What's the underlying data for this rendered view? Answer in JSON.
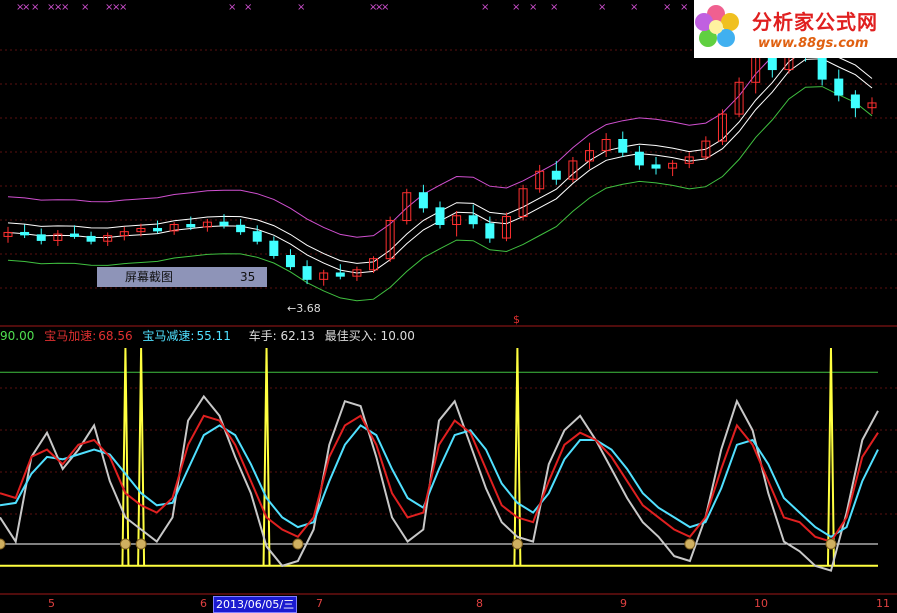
{
  "chart_data": [
    {
      "type": "candlestick",
      "panel": "price",
      "title": "",
      "low_marker_label": "←3.68",
      "colors": {
        "up": "#ff3030",
        "down": "#40ffff",
        "upper_band": "#d050d0",
        "mid_line": "#ffffff",
        "lower_band": "#40c040"
      },
      "candles": [
        {
          "o": 4.3,
          "h": 4.42,
          "l": 4.22,
          "c": 4.35
        },
        {
          "o": 4.35,
          "h": 4.45,
          "l": 4.28,
          "c": 4.32
        },
        {
          "o": 4.32,
          "h": 4.4,
          "l": 4.2,
          "c": 4.25
        },
        {
          "o": 4.25,
          "h": 4.38,
          "l": 4.18,
          "c": 4.33
        },
        {
          "o": 4.33,
          "h": 4.44,
          "l": 4.27,
          "c": 4.3
        },
        {
          "o": 4.3,
          "h": 4.36,
          "l": 4.2,
          "c": 4.24
        },
        {
          "o": 4.24,
          "h": 4.35,
          "l": 4.18,
          "c": 4.31
        },
        {
          "o": 4.31,
          "h": 4.42,
          "l": 4.25,
          "c": 4.36
        },
        {
          "o": 4.36,
          "h": 4.46,
          "l": 4.3,
          "c": 4.4
        },
        {
          "o": 4.4,
          "h": 4.5,
          "l": 4.34,
          "c": 4.37
        },
        {
          "o": 4.37,
          "h": 4.48,
          "l": 4.32,
          "c": 4.45
        },
        {
          "o": 4.45,
          "h": 4.55,
          "l": 4.38,
          "c": 4.42
        },
        {
          "o": 4.42,
          "h": 4.52,
          "l": 4.36,
          "c": 4.48
        },
        {
          "o": 4.48,
          "h": 4.58,
          "l": 4.4,
          "c": 4.44
        },
        {
          "o": 4.44,
          "h": 4.52,
          "l": 4.32,
          "c": 4.36
        },
        {
          "o": 4.36,
          "h": 4.44,
          "l": 4.2,
          "c": 4.24
        },
        {
          "o": 4.24,
          "h": 4.3,
          "l": 4.02,
          "c": 4.06
        },
        {
          "o": 4.06,
          "h": 4.14,
          "l": 3.88,
          "c": 3.92
        },
        {
          "o": 3.92,
          "h": 4.0,
          "l": 3.7,
          "c": 3.76
        },
        {
          "o": 3.76,
          "h": 3.88,
          "l": 3.68,
          "c": 3.84
        },
        {
          "o": 3.84,
          "h": 3.95,
          "l": 3.76,
          "c": 3.8
        },
        {
          "o": 3.8,
          "h": 3.92,
          "l": 3.74,
          "c": 3.88
        },
        {
          "o": 3.88,
          "h": 4.05,
          "l": 3.84,
          "c": 4.02
        },
        {
          "o": 4.02,
          "h": 4.55,
          "l": 3.98,
          "c": 4.5
        },
        {
          "o": 4.5,
          "h": 4.9,
          "l": 4.45,
          "c": 4.85
        },
        {
          "o": 4.85,
          "h": 4.95,
          "l": 4.6,
          "c": 4.66
        },
        {
          "o": 4.66,
          "h": 4.74,
          "l": 4.4,
          "c": 4.45
        },
        {
          "o": 4.45,
          "h": 4.62,
          "l": 4.3,
          "c": 4.56
        },
        {
          "o": 4.56,
          "h": 4.7,
          "l": 4.4,
          "c": 4.46
        },
        {
          "o": 4.46,
          "h": 4.55,
          "l": 4.22,
          "c": 4.28
        },
        {
          "o": 4.28,
          "h": 4.6,
          "l": 4.24,
          "c": 4.55
        },
        {
          "o": 4.55,
          "h": 4.95,
          "l": 4.5,
          "c": 4.9
        },
        {
          "o": 4.9,
          "h": 5.2,
          "l": 4.85,
          "c": 5.12
        },
        {
          "o": 5.12,
          "h": 5.25,
          "l": 4.95,
          "c": 5.02
        },
        {
          "o": 5.02,
          "h": 5.3,
          "l": 4.98,
          "c": 5.25
        },
        {
          "o": 5.25,
          "h": 5.48,
          "l": 5.15,
          "c": 5.38
        },
        {
          "o": 5.38,
          "h": 5.6,
          "l": 5.3,
          "c": 5.52
        },
        {
          "o": 5.52,
          "h": 5.62,
          "l": 5.3,
          "c": 5.36
        },
        {
          "o": 5.36,
          "h": 5.44,
          "l": 5.14,
          "c": 5.2
        },
        {
          "o": 5.2,
          "h": 5.3,
          "l": 5.08,
          "c": 5.16
        },
        {
          "o": 5.16,
          "h": 5.26,
          "l": 5.06,
          "c": 5.22
        },
        {
          "o": 5.22,
          "h": 5.36,
          "l": 5.16,
          "c": 5.3
        },
        {
          "o": 5.3,
          "h": 5.56,
          "l": 5.26,
          "c": 5.5
        },
        {
          "o": 5.5,
          "h": 5.9,
          "l": 5.45,
          "c": 5.84
        },
        {
          "o": 5.84,
          "h": 6.3,
          "l": 5.8,
          "c": 6.24
        },
        {
          "o": 6.24,
          "h": 6.7,
          "l": 6.1,
          "c": 6.6
        },
        {
          "o": 6.6,
          "h": 6.85,
          "l": 6.3,
          "c": 6.4
        },
        {
          "o": 6.4,
          "h": 6.9,
          "l": 6.35,
          "c": 6.82
        },
        {
          "o": 6.82,
          "h": 7.05,
          "l": 6.5,
          "c": 6.58
        },
        {
          "o": 6.58,
          "h": 6.78,
          "l": 6.2,
          "c": 6.28
        },
        {
          "o": 6.28,
          "h": 6.4,
          "l": 6.0,
          "c": 6.08
        },
        {
          "o": 6.08,
          "h": 6.14,
          "l": 5.8,
          "c": 5.92
        },
        {
          "o": 5.92,
          "h": 6.05,
          "l": 5.84,
          "c": 5.98
        }
      ]
    },
    {
      "type": "line",
      "panel": "indicator",
      "series": [
        {
          "name": "宝马加速",
          "color": "#e02020",
          "values": [
            40,
            38,
            55,
            58,
            52,
            60,
            62,
            55,
            40,
            35,
            32,
            38,
            60,
            72,
            70,
            60,
            45,
            30,
            25,
            22,
            30,
            55,
            68,
            72,
            60,
            40,
            30,
            32,
            60,
            70,
            65,
            50,
            35,
            30,
            28,
            45,
            60,
            65,
            62,
            55,
            45,
            35,
            30,
            25,
            22,
            30,
            50,
            68,
            60,
            45,
            30,
            28,
            22,
            20,
            30,
            55,
            65
          ]
        },
        {
          "name": "宝马减速",
          "color": "#50e0ff",
          "values": [
            35,
            36,
            48,
            55,
            54,
            56,
            58,
            56,
            48,
            40,
            35,
            36,
            50,
            64,
            68,
            64,
            52,
            38,
            30,
            26,
            28,
            45,
            60,
            68,
            64,
            50,
            38,
            34,
            50,
            64,
            66,
            58,
            44,
            36,
            32,
            40,
            54,
            62,
            62,
            58,
            50,
            40,
            34,
            30,
            26,
            28,
            42,
            60,
            62,
            52,
            38,
            32,
            26,
            22,
            26,
            45,
            58
          ]
        },
        {
          "name": "车手",
          "color": "#c8c8c8",
          "values": [
            30,
            20,
            55,
            65,
            50,
            58,
            68,
            45,
            30,
            25,
            20,
            30,
            70,
            80,
            72,
            55,
            40,
            18,
            10,
            12,
            25,
            60,
            78,
            76,
            55,
            30,
            20,
            25,
            70,
            78,
            60,
            42,
            28,
            22,
            20,
            52,
            66,
            72,
            62,
            50,
            38,
            28,
            22,
            14,
            12,
            30,
            58,
            78,
            66,
            40,
            20,
            16,
            10,
            8,
            32,
            62,
            74
          ]
        }
      ],
      "legend": {
        "level": "90.00",
        "accel_label": "宝马加速:",
        "accel_value": "68.56",
        "decel_label": "宝马减速:",
        "decel_value": "55.11",
        "driver": "车手: 62.13",
        "best_buy": "最佳买入: 10.00"
      },
      "reference_lines": [
        90,
        10
      ],
      "signal_spikes": [
        8,
        9,
        17,
        33,
        53
      ]
    }
  ],
  "popup": {
    "title": "屏幕截图",
    "value": "35"
  },
  "logo": {
    "name": "分析家公式网",
    "url": "www.88gs.com"
  },
  "x_axis": {
    "labels": [
      "5",
      "6",
      "7",
      "8",
      "9",
      "10",
      "11"
    ],
    "current_date": "2013/06/05/三"
  },
  "money_marker": "$"
}
